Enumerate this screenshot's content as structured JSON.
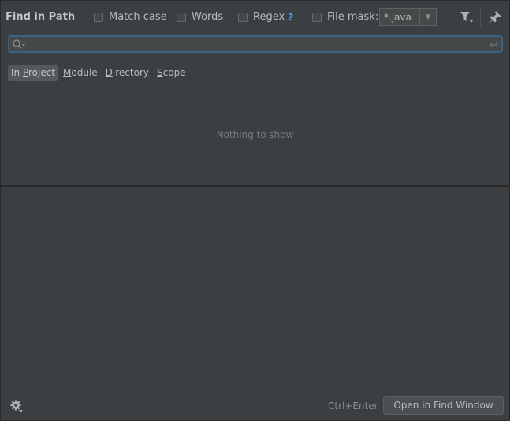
{
  "header": {
    "title": "Find in Path",
    "options": {
      "match_case": "Match case",
      "words": "Words",
      "regex": "Regex",
      "regex_help": "?",
      "file_mask": "File mask:"
    },
    "file_mask_value": "*.java"
  },
  "search": {
    "value": "",
    "placeholder": ""
  },
  "scope_tabs": {
    "in_project": {
      "pre": "In ",
      "key": "P",
      "post": "roject"
    },
    "module": {
      "key": "M",
      "rest": "odule"
    },
    "directory": {
      "key": "D",
      "rest": "irectory"
    },
    "scope": {
      "key": "S",
      "rest": "cope"
    }
  },
  "results": {
    "empty_text": "Nothing to show"
  },
  "footer": {
    "shortcut": "Ctrl+Enter",
    "open_button": "Open in Find Window"
  },
  "colors": {
    "background": "#3c3f41",
    "focus_border": "#3d6185",
    "help_accent": "#589df6"
  },
  "icons": {
    "search": "search-icon",
    "filter": "filter-icon",
    "pin": "pin-icon",
    "enter": "enter-icon",
    "settings": "gear-icon",
    "dropdown": "chevron-down-icon"
  }
}
